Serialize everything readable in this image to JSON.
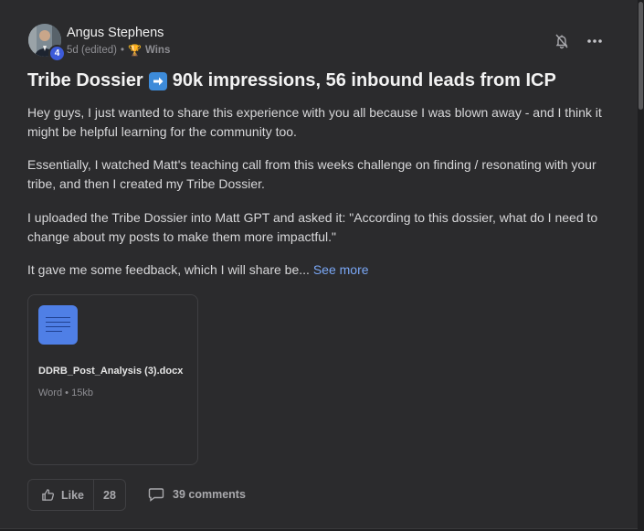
{
  "post": {
    "author": {
      "name": "Angus Stephens",
      "level": "4",
      "avatar": "avatar-photo"
    },
    "meta": {
      "time": "5d (edited)",
      "separator": "•",
      "category_icon": "trophy-icon",
      "category_emoji": "🏆",
      "category": "Wins"
    },
    "title": {
      "before": "Tribe Dossier",
      "arrow_icon": "right-arrow-emoji-icon",
      "after": "90k impressions, 56 inbound leads from ICP"
    },
    "paragraphs": [
      "Hey guys, I just wanted to share this experience with you all because I was blown away - and I think it might be helpful learning for the community too.",
      "Essentially, I watched Matt's teaching call from this weeks challenge on finding / resonating with your tribe, and then I created my Tribe Dossier.",
      "I uploaded the Tribe Dossier into Matt GPT and asked it: \"According to this dossier, what do I need to change about my posts to make them more impactful.\""
    ],
    "truncated": {
      "text": "It gave me some feedback, which I will share be...",
      "see_more": "See more"
    },
    "attachment": {
      "icon": "document-icon",
      "file_name": "DDRB_Post_Analysis (3).docx",
      "file_type": "Word",
      "separator": "•",
      "file_size": "15kb"
    },
    "actions": {
      "like_label": "Like",
      "like_count": "28",
      "comments_label": "39 comments"
    }
  },
  "colors": {
    "background": "#2b2b2d",
    "text": "#d7d7d9",
    "link": "#7aa7f5",
    "level_badge": "#3d5bd9",
    "doc_icon": "#4f7fe6"
  }
}
